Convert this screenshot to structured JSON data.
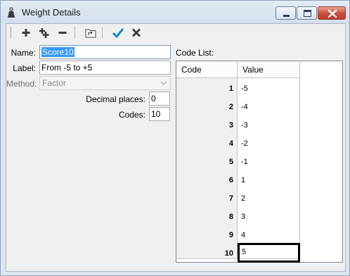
{
  "window": {
    "title": "Weight Details",
    "icons": {
      "app": "weight-icon",
      "minimize": "minimize-icon",
      "maximize": "maximize-icon",
      "close": "close-icon"
    }
  },
  "toolbar": {
    "icons": [
      "add-icon",
      "add-multiple-icon",
      "remove-icon",
      "import-icon",
      "confirm-check-icon",
      "cancel-x-icon"
    ],
    "accent_check": "#1a86c8"
  },
  "form": {
    "name_label": "Name:",
    "name_value": "Score10",
    "label_label": "Label:",
    "label_value": "From -5 to +5",
    "method_label": "Method:",
    "method_value": "Factor",
    "decimal_label": "Decimal places:",
    "decimal_value": "0",
    "codes_label": "Codes:",
    "codes_value": "10"
  },
  "code_list": {
    "label": "Code List:",
    "columns": [
      "Code",
      "Value"
    ],
    "rows": [
      {
        "code": "1",
        "value": "-5"
      },
      {
        "code": "2",
        "value": "-4"
      },
      {
        "code": "3",
        "value": "-3"
      },
      {
        "code": "4",
        "value": "-2"
      },
      {
        "code": "5",
        "value": "-1"
      },
      {
        "code": "6",
        "value": "1"
      },
      {
        "code": "7",
        "value": "2"
      },
      {
        "code": "8",
        "value": "3"
      },
      {
        "code": "9",
        "value": "4"
      },
      {
        "code": "10",
        "value": "5"
      }
    ],
    "active_row": 9
  }
}
